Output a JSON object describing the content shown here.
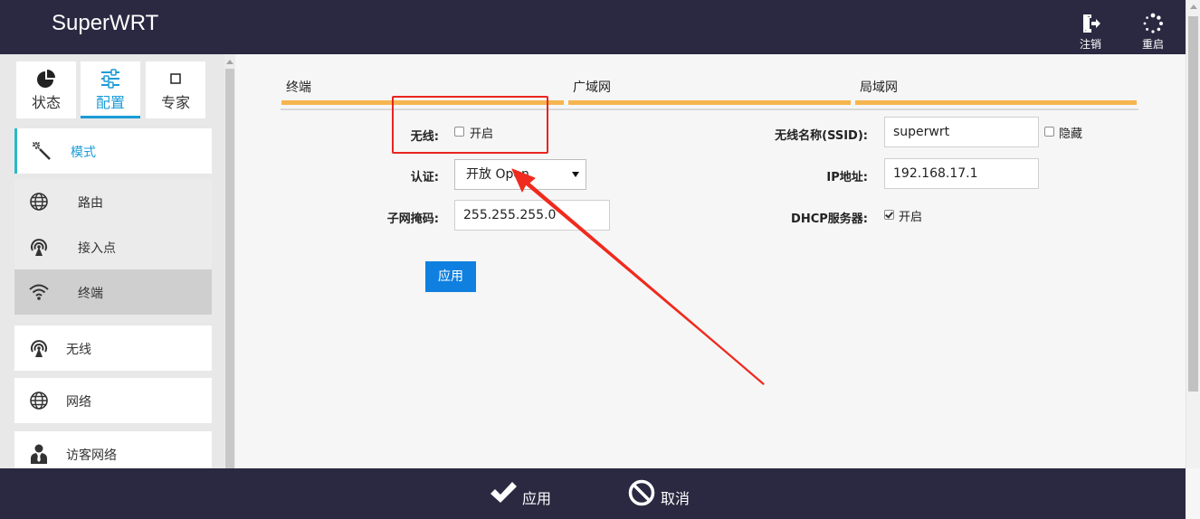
{
  "app": {
    "title": "SuperWRT"
  },
  "header": {
    "logout_label": "注销",
    "reboot_label": "重启"
  },
  "sidebar": {
    "tabs": [
      {
        "label": "状态",
        "icon": "pie-chart-icon"
      },
      {
        "label": "配置",
        "icon": "sliders-icon"
      },
      {
        "label": "专家",
        "icon": "square-icon"
      }
    ],
    "active_tab": "配置",
    "items": [
      {
        "label": "模式",
        "icon": "magic-wand-icon"
      },
      {
        "label": "路由",
        "icon": "globe-icon"
      },
      {
        "label": "接入点",
        "icon": "broadcast-icon"
      },
      {
        "label": "终端",
        "icon": "wifi-icon"
      },
      {
        "label": "无线",
        "icon": "broadcast-icon"
      },
      {
        "label": "网络",
        "icon": "globe-icon"
      },
      {
        "label": "访客网络",
        "icon": "user-tie-icon"
      }
    ]
  },
  "main": {
    "tabs": [
      {
        "label": "终端"
      },
      {
        "label": "广域网"
      },
      {
        "label": "局域网"
      }
    ],
    "form": {
      "wireless": {
        "label": "无线:",
        "checkbox_label": "开启",
        "checked": false
      },
      "auth": {
        "label": "认证:",
        "value": "开放 Open"
      },
      "netmask": {
        "label": "子网掩码:",
        "value": "255.255.255.0"
      },
      "ssid": {
        "label": "无线名称(SSID):",
        "value": "superwrt",
        "hide_label": "隐藏",
        "hidden": false
      },
      "ip": {
        "label": "IP地址:",
        "value": "192.168.17.1"
      },
      "dhcp": {
        "label": "DHCP服务器:",
        "checkbox_label": "开启",
        "checked": true
      },
      "apply_label": "应用"
    }
  },
  "footer": {
    "apply_label": "应用",
    "cancel_label": "取消"
  },
  "colors": {
    "bar": "#2a2941",
    "accent": "#1a9bd7",
    "tab_underline": "#f6b54e",
    "primary_button": "#1080e0",
    "annotation": "#e8251f"
  }
}
